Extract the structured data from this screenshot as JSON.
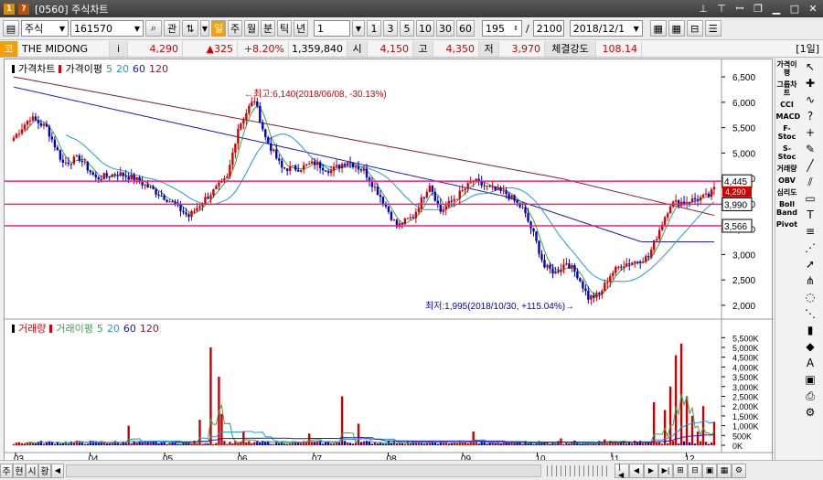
{
  "window": {
    "title": "[0560] 주식차트",
    "controls": [
      "pin-icon",
      "pin2-icon",
      "pin3-icon",
      "restore-icon",
      "minimize-icon",
      "maximize-icon",
      "close-icon"
    ]
  },
  "toolbar": {
    "market": "주식",
    "code": "161570",
    "search_icon": "search-icon",
    "rel_label": "관",
    "period_buttons": [
      "주",
      "월",
      "분",
      "틱",
      "년"
    ],
    "unit_value": "1",
    "interval_buttons": [
      "1",
      "3",
      "5",
      "10",
      "30",
      "60"
    ],
    "count_value": "195",
    "total_value": "2100",
    "date_value": "2018/12/1"
  },
  "info": {
    "type_label": "코",
    "name": "THE MIDONG",
    "info_icon": "i",
    "price": "4,290",
    "change": "▲325",
    "rate": "+8.20%",
    "volume": "1,359,840",
    "open_label": "시",
    "open": "4,150",
    "high_label": "고",
    "high": "4,350",
    "low_label": "저",
    "low": "3,970",
    "strength_label": "체결강도",
    "strength": "108.14",
    "period_tag": "[1일]"
  },
  "price_panel": {
    "legend_title": "가격차트",
    "ma_label": "가격이평",
    "ma_periods": [
      "5",
      "20",
      "60",
      "120"
    ],
    "ma_colors": [
      "#3aa54a",
      "#1a9fd6",
      "#1a1acd",
      "#8b1a3a"
    ],
    "y_ticks": [
      2000,
      2500,
      3000,
      3500,
      4000,
      4500,
      5000,
      5500,
      6000,
      6500
    ],
    "y_tick_labels": [
      "2,000",
      "2,500",
      "3,000",
      "3,500",
      "4,000",
      "4,500",
      "5,000",
      "5,500",
      "6,000",
      "6,500"
    ],
    "high_annotation": "←최고:6,140(2018/06/08, -30.13%)",
    "low_annotation": "최저:1,995(2018/10/30, +115.04%)→",
    "hlines": [
      {
        "value": 4445,
        "label": "4,445"
      },
      {
        "value": 3990,
        "label": "3,990"
      },
      {
        "value": 3566,
        "label": "3,566"
      }
    ],
    "current_label": "4,290",
    "current_sub": "0,302"
  },
  "volume_panel": {
    "legend_title": "거래량",
    "ma_label": "거래이평",
    "ma_periods": [
      "5",
      "20",
      "60",
      "120"
    ],
    "y_ticks": [
      0,
      500000,
      1000000,
      1500000,
      2000000,
      2500000,
      3000000,
      3500000,
      4000000,
      4500000,
      5000000,
      5500000
    ],
    "y_tick_labels": [
      "0K",
      "500K",
      "1,000K",
      "1,500K",
      "2,000K",
      "2,500K",
      "3,000K",
      "3,500K",
      "4,000K",
      "4,500K",
      "5,000K",
      "5,500K"
    ]
  },
  "x_axis": {
    "months": [
      "03",
      "04",
      "05",
      "06",
      "07",
      "08",
      "09",
      "10",
      "11",
      "12"
    ]
  },
  "right_tools": {
    "col1": [
      "가격이평",
      "그룹차트",
      "CCI",
      "MACD",
      "F-Stoc",
      "S-Stoc",
      "거래량",
      "OBV",
      "심리도",
      "Boll Band",
      "Pivot"
    ],
    "col2": [
      "cursor-icon",
      "crosshair-icon",
      "wave-icon",
      "question-icon",
      "plus-icon",
      "draw-icon",
      "line-icon",
      "channel-icon",
      "rect-icon",
      "text-icon",
      "fib-icon",
      "gann-icon",
      "arrow-icon",
      "speed-icon",
      "cycle-icon",
      "fan-icon",
      "bar-icon",
      "color-icon",
      "auto-icon",
      "save-icon",
      "print-icon",
      "settings-icon"
    ]
  },
  "bottom": {
    "tabs": [
      "주",
      "현",
      "시",
      "황"
    ]
  },
  "chart_data": {
    "type": "candlestick",
    "x": [
      "03",
      "04",
      "05",
      "06",
      "07",
      "08",
      "09",
      "10",
      "11",
      "12"
    ],
    "series": [
      {
        "name": "종가",
        "values": [
          5400,
          4600,
          4000,
          5300,
          4700,
          4500,
          4300,
          3100,
          2900,
          4290
        ]
      },
      {
        "name": "이평 120",
        "values": [
          6500,
          6000,
          5600,
          5300,
          5000,
          4700,
          4450,
          4200,
          4100,
          4000
        ]
      },
      {
        "name": "이평 60",
        "values": [
          6300,
          5500,
          4700,
          4900,
          4800,
          4500,
          4300,
          3900,
          3400,
          3250
        ]
      }
    ],
    "ylim": [
      1995,
      6140
    ],
    "ylabel": ""
  }
}
